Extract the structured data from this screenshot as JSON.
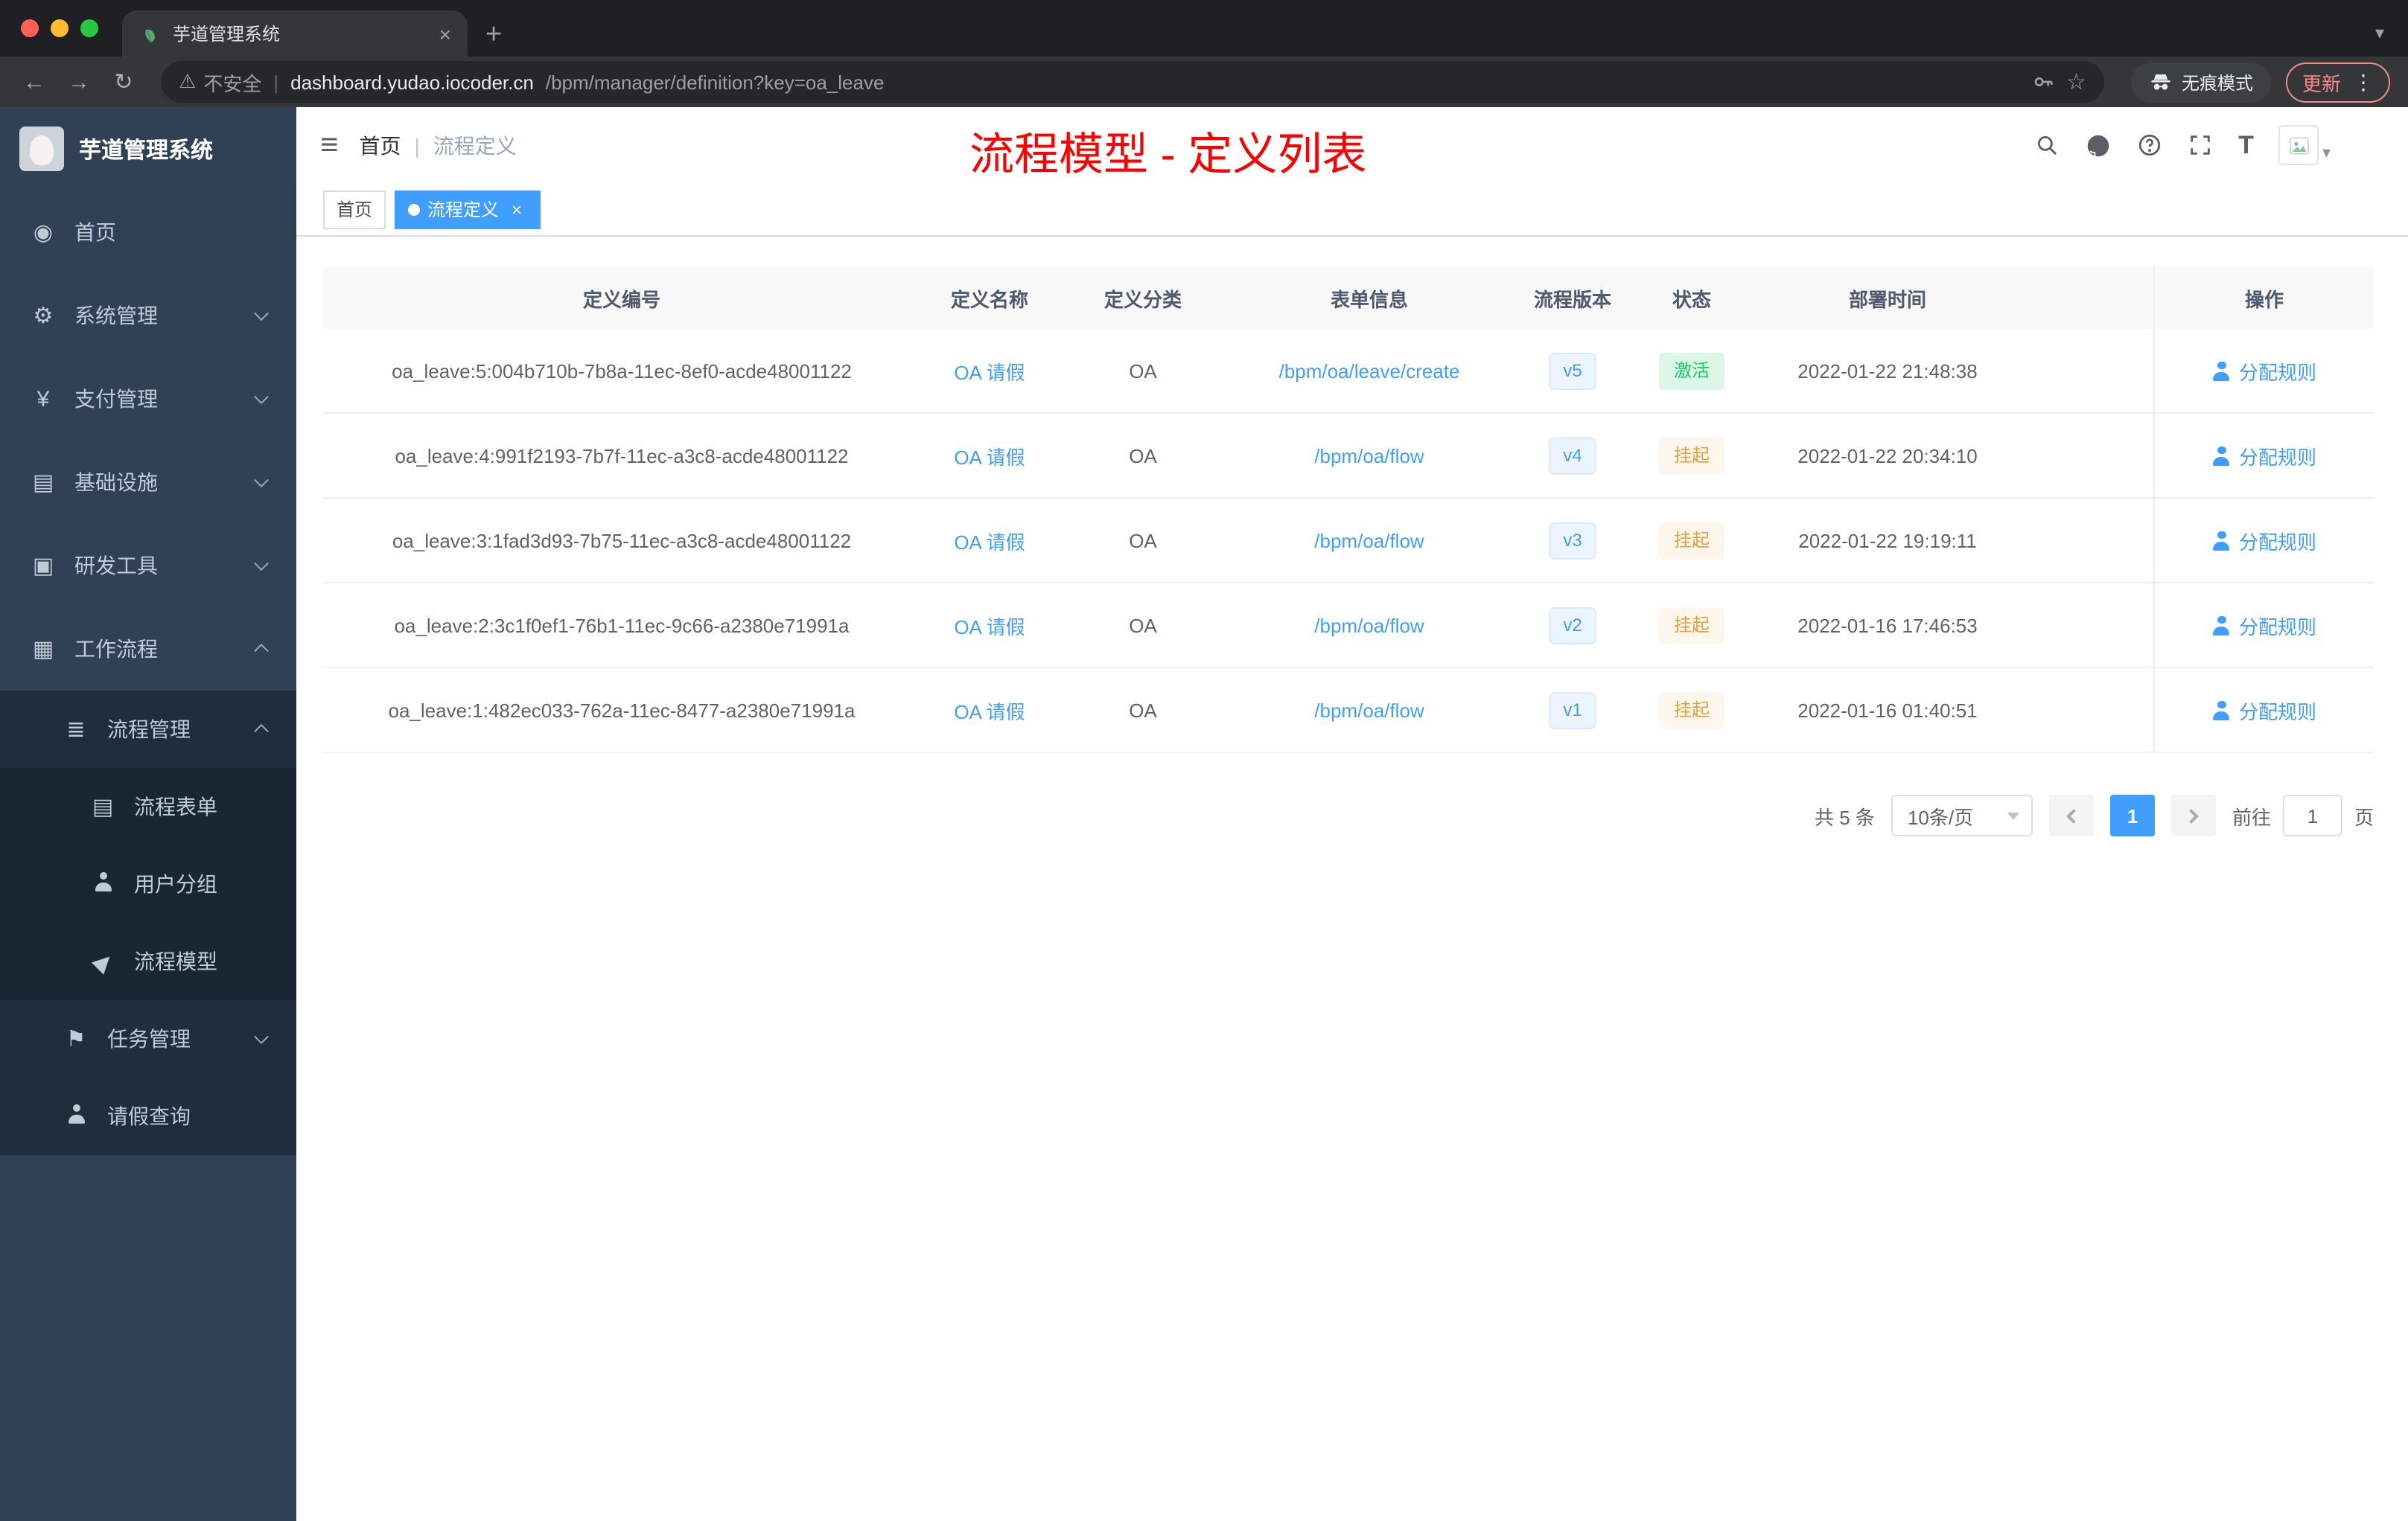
{
  "browser": {
    "tab_title": "芋道管理系统",
    "security_label": "不安全",
    "url_host": "dashboard.yudao.iocoder.cn",
    "url_path": "/bpm/manager/definition?key=oa_leave",
    "incognito_label": "无痕模式",
    "update_label": "更新"
  },
  "icons": {
    "close": "×",
    "new_tab": "+",
    "caret_down": "▾",
    "back": "←",
    "forward": "→",
    "reload": "↻",
    "warning": "⚠",
    "star": "☆",
    "kebab": "⋮",
    "hamburger": "≡",
    "divider": "|",
    "font_size": "T"
  },
  "sidebar": {
    "logo_title": "芋道管理系统",
    "items": [
      {
        "label": "首页",
        "icon": "◉"
      },
      {
        "label": "系统管理",
        "icon": "⚙"
      },
      {
        "label": "支付管理",
        "icon": "¥"
      },
      {
        "label": "基础设施",
        "icon": "▤"
      },
      {
        "label": "研发工具",
        "icon": "▣"
      },
      {
        "label": "工作流程",
        "icon": "▦"
      },
      {
        "label": "流程管理",
        "icon": "≣"
      },
      {
        "label": "流程表单",
        "icon": "▤"
      },
      {
        "label": "用户分组",
        "icon": ""
      },
      {
        "label": "流程模型",
        "icon": "▶"
      },
      {
        "label": "任务管理",
        "icon": "⚑"
      },
      {
        "label": "请假查询",
        "icon": ""
      }
    ]
  },
  "navbar": {
    "breadcrumb": [
      "首页",
      "流程定义"
    ],
    "annotation": "流程模型 - 定义列表"
  },
  "tags": [
    {
      "label": "首页"
    },
    {
      "label": "流程定义"
    }
  ],
  "table": {
    "columns": [
      "定义编号",
      "定义名称",
      "定义分类",
      "表单信息",
      "流程版本",
      "状态",
      "部署时间",
      "操作"
    ],
    "rows": [
      {
        "id": "oa_leave:5:004b710b-7b8a-11ec-8ef0-acde48001122",
        "name": "OA 请假",
        "category": "OA",
        "form": "/bpm/oa/leave/create",
        "version": "v5",
        "status": "激活",
        "time": "2022-01-22 21:48:38",
        "action": "分配规则"
      },
      {
        "id": "oa_leave:4:991f2193-7b7f-11ec-a3c8-acde48001122",
        "name": "OA 请假",
        "category": "OA",
        "form": "/bpm/oa/flow",
        "version": "v4",
        "status": "挂起",
        "time": "2022-01-22 20:34:10",
        "action": "分配规则"
      },
      {
        "id": "oa_leave:3:1fad3d93-7b75-11ec-a3c8-acde48001122",
        "name": "OA 请假",
        "category": "OA",
        "form": "/bpm/oa/flow",
        "version": "v3",
        "status": "挂起",
        "time": "2022-01-22 19:19:11",
        "action": "分配规则"
      },
      {
        "id": "oa_leave:2:3c1f0ef1-76b1-11ec-9c66-a2380e71991a",
        "name": "OA 请假",
        "category": "OA",
        "form": "/bpm/oa/flow",
        "version": "v2",
        "status": "挂起",
        "time": "2022-01-16 17:46:53",
        "action": "分配规则"
      },
      {
        "id": "oa_leave:1:482ec033-762a-11ec-8477-a2380e71991a",
        "name": "OA 请假",
        "category": "OA",
        "form": "/bpm/oa/flow",
        "version": "v1",
        "status": "挂起",
        "time": "2022-01-16 01:40:51",
        "action": "分配规则"
      }
    ]
  },
  "pagination": {
    "total": "共 5 条",
    "page_size": "10条/页",
    "current_page": "1",
    "goto_label": "前往",
    "goto_value": "1",
    "goto_unit": "页"
  },
  "colors": {
    "accent": "#409eff",
    "success": "#13ce66",
    "warning": "#e6a23c",
    "annotation_red": "#ff0000",
    "sidebar_bg": "#304156",
    "sidebar_submenu_bg": "#1f2d3d",
    "active_tag_bg": "#409eff"
  }
}
